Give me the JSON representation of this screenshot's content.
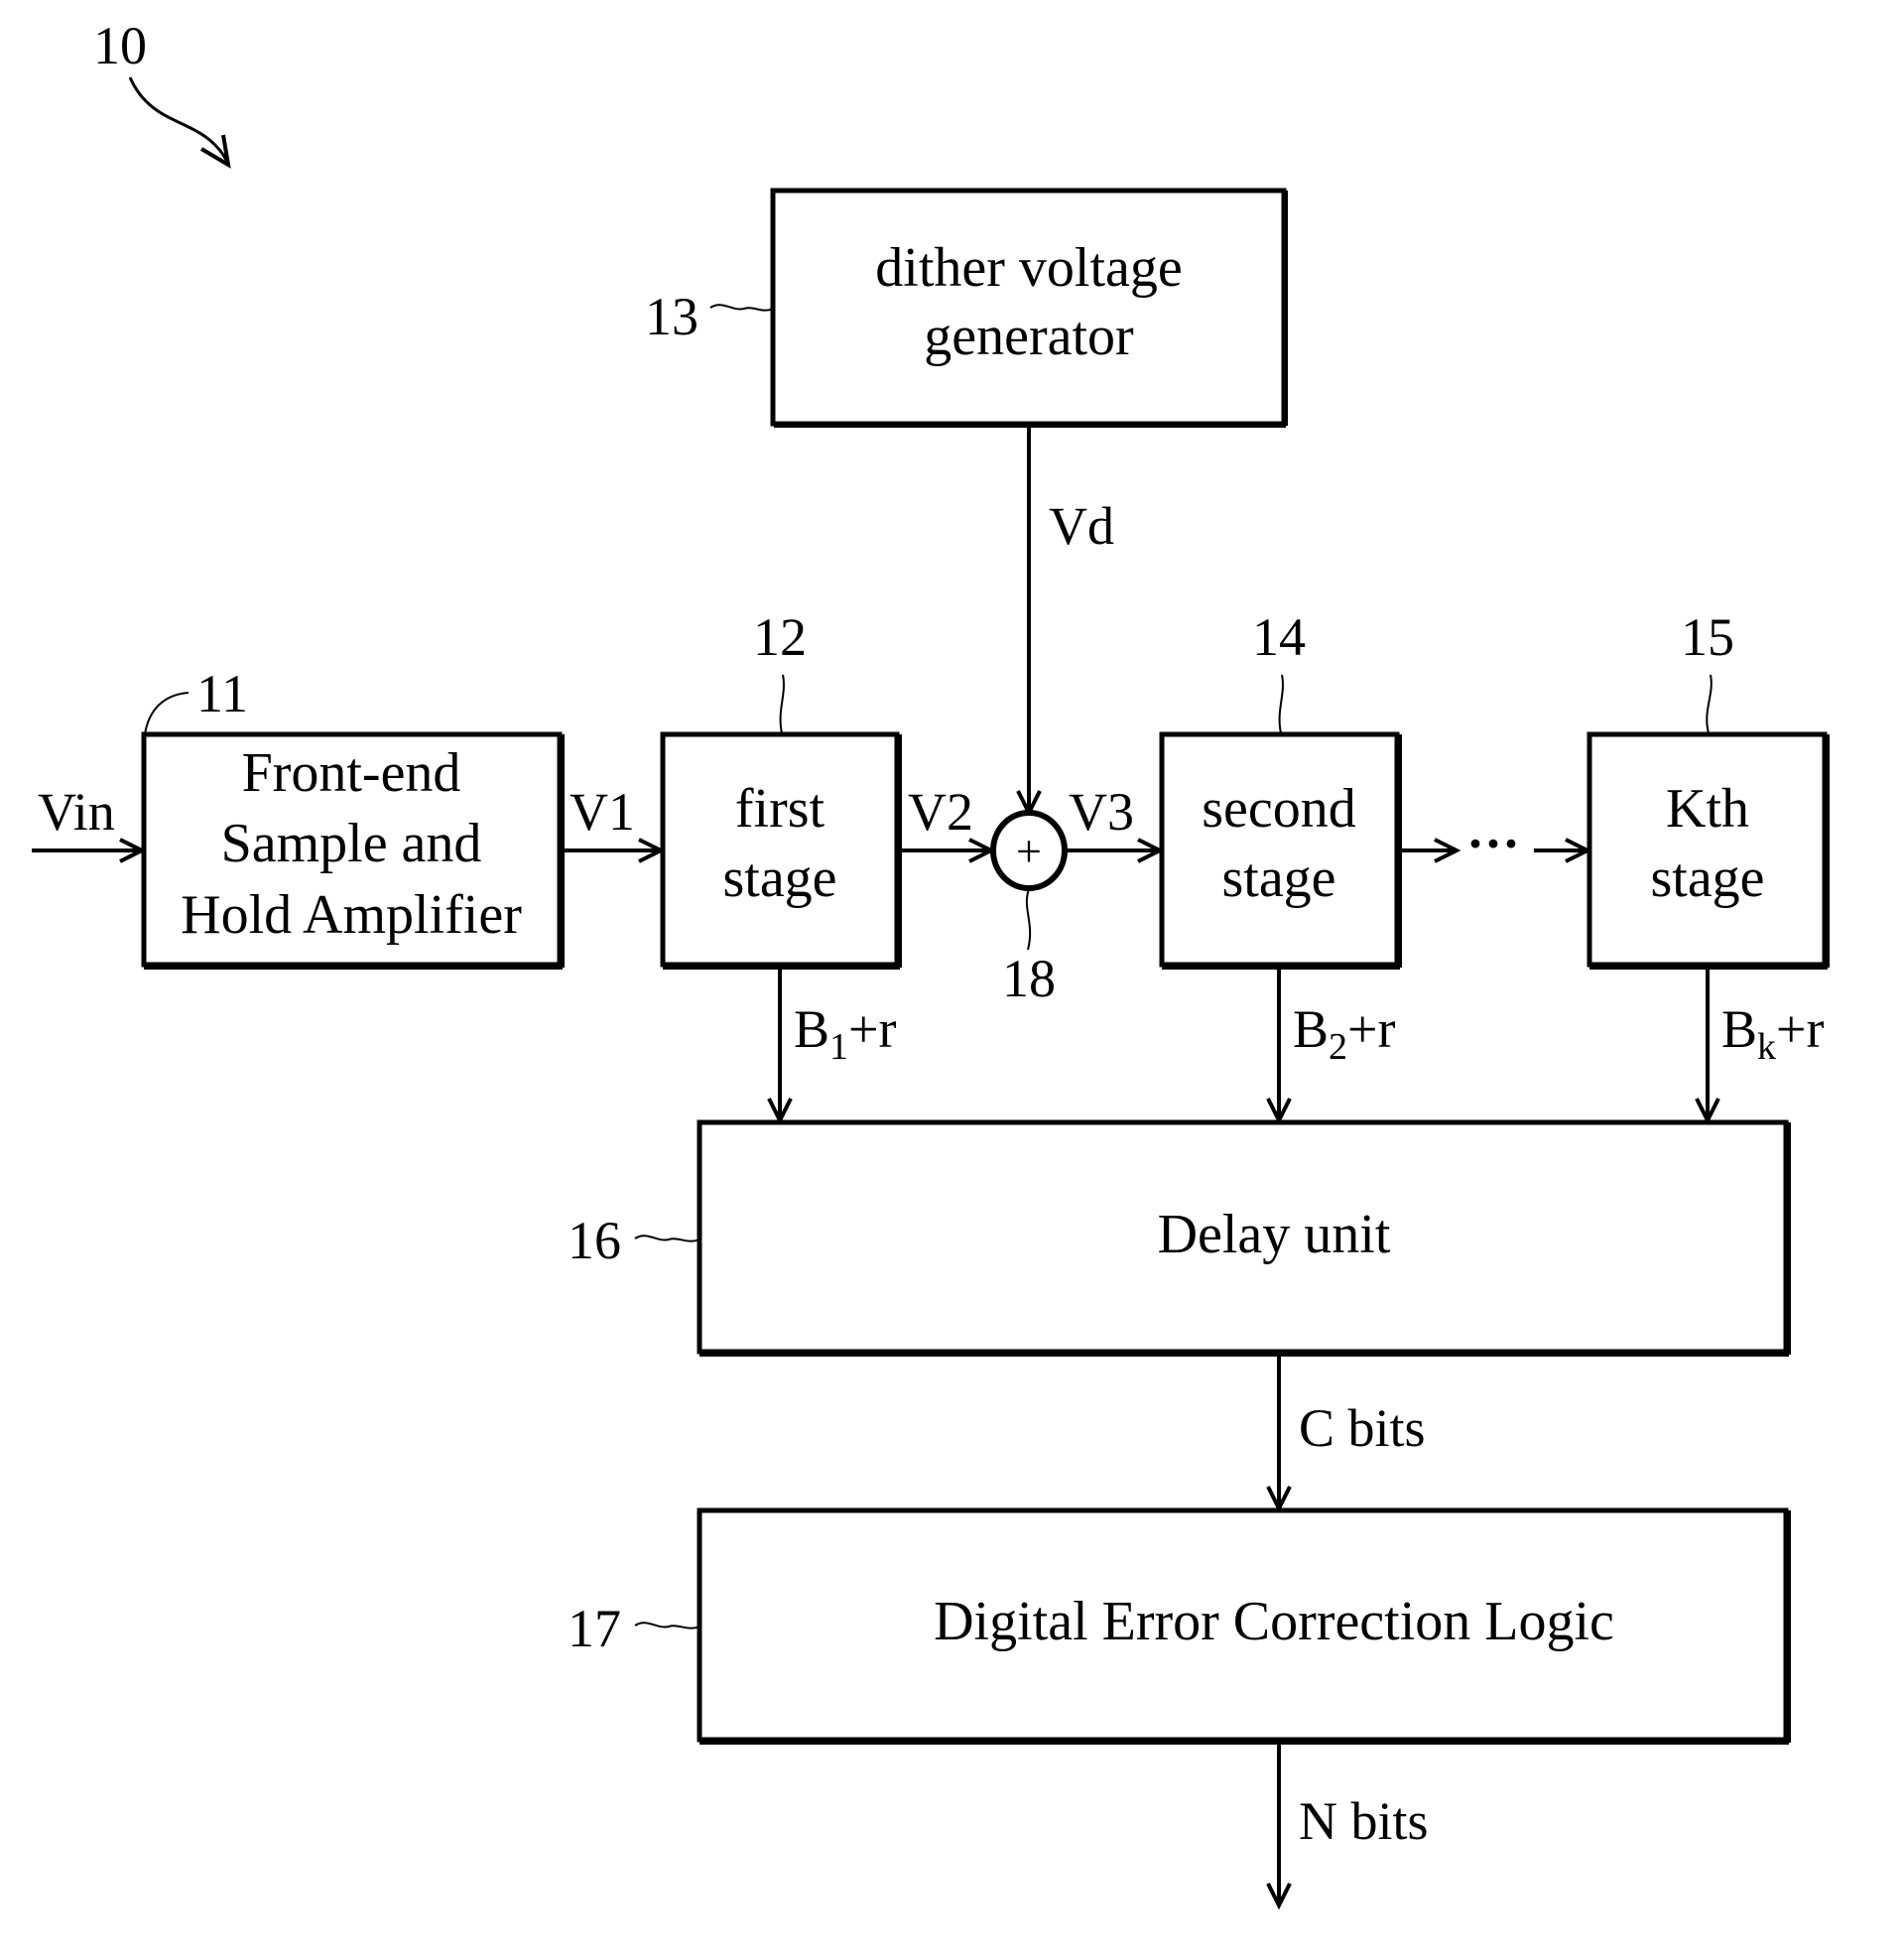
{
  "figure": {
    "ref_number": "10"
  },
  "blocks": {
    "front_end": {
      "ref": "11",
      "lines": [
        "Front-end",
        "Sample and",
        "Hold Amplifier"
      ]
    },
    "first_stage": {
      "ref": "12",
      "lines": [
        "first",
        "stage"
      ]
    },
    "dither": {
      "ref": "13",
      "lines": [
        "dither voltage",
        "generator"
      ]
    },
    "second_stage": {
      "ref": "14",
      "lines": [
        "second",
        "stage"
      ]
    },
    "kth_stage": {
      "ref": "15",
      "lines": [
        "Kth",
        "stage"
      ]
    },
    "delay": {
      "ref": "16",
      "label": "Delay unit"
    },
    "dec": {
      "ref": "17",
      "label": "Digital Error Correction Logic"
    },
    "adder": {
      "ref": "18",
      "symbol": "+"
    }
  },
  "signals": {
    "vin": "Vin",
    "v1": "V1",
    "v2": "V2",
    "v3": "V3",
    "vd": "Vd",
    "ellipsis": "···",
    "b1": {
      "base": "B",
      "sub": "1",
      "suffix": "+r"
    },
    "b2": {
      "base": "B",
      "sub": "2",
      "suffix": "+r"
    },
    "bk": {
      "base": "B",
      "sub": "k",
      "suffix": "+r"
    },
    "c_bits": "C bits",
    "n_bits": "N bits"
  }
}
